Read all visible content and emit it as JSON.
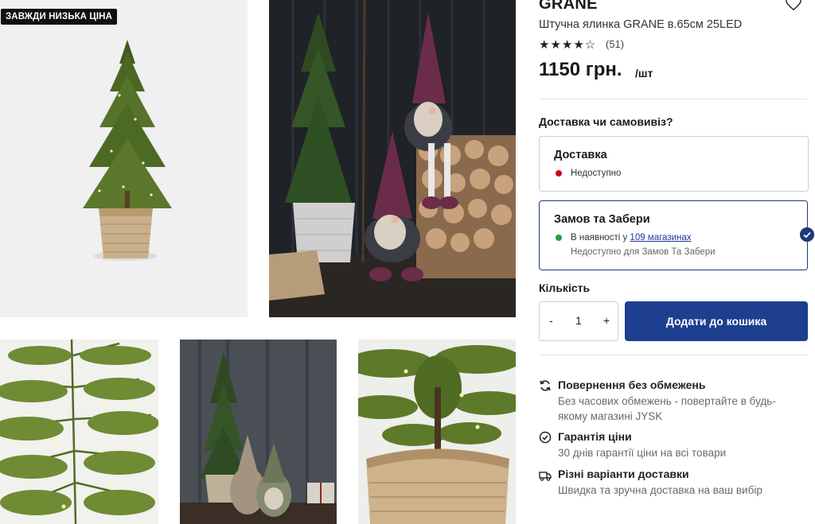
{
  "gallery": {
    "badge": "ЗАВЖДИ НИЗЬКА ЦІНА"
  },
  "product": {
    "brand": "GRANE",
    "name": "Штучна ялинка GRANE в.65см 25LED",
    "stars": "★★★★☆",
    "rating_value": 4,
    "review_count": "(51)",
    "price": "1150 грн.",
    "unit": "/шт"
  },
  "delivery": {
    "title": "Доставка чи самовивіз?",
    "option_delivery": {
      "label": "Доставка",
      "status": "Недоступно",
      "status_color": "#d0021b"
    },
    "option_pickup": {
      "label": "Замов та Забери",
      "status_prefix": "В наявності у",
      "status_link": "109 магазинах",
      "status_color": "#2e9e44",
      "note": "Недоступно для Замов Та Забери"
    }
  },
  "quantity": {
    "label": "Кількість",
    "minus": "-",
    "value": "1",
    "plus": "+"
  },
  "cart": {
    "add_label": "Додати до кошика"
  },
  "features": [
    {
      "icon": "refresh-icon",
      "title": "Повернення без обмежень",
      "desc": "Без часових обмежень - повертайте в будь-якому магазині JYSK"
    },
    {
      "icon": "check-circle-icon",
      "title": "Гарантія ціни",
      "desc": "30 днів гарантії ціни на всі товари"
    },
    {
      "icon": "truck-icon",
      "title": "Різні варіанти доставки",
      "desc": "Швидка та зручна доставка на ваш вибір"
    }
  ],
  "colors": {
    "primary": "#1e3f8f",
    "unavailable": "#d0021b",
    "available": "#2e9e44"
  }
}
